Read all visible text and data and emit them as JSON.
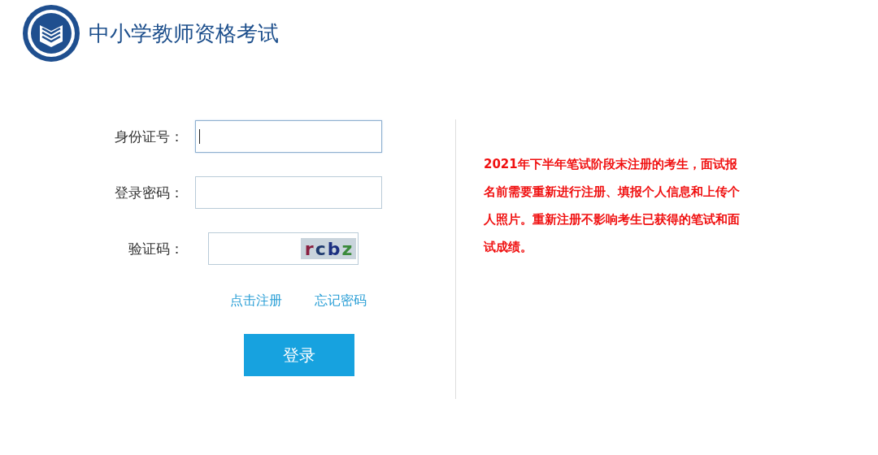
{
  "header": {
    "title": "中小学教师资格考试"
  },
  "form": {
    "fields": [
      {
        "kind": "text",
        "label": "身份证号：",
        "focused": true
      },
      {
        "kind": "password",
        "label": "登录密码：",
        "focused": false
      },
      {
        "kind": "captcha",
        "label": "验证码：",
        "focused": false,
        "captcha": "rcbz"
      }
    ],
    "links": [
      "点击注册",
      "忘记密码"
    ],
    "submit": "登录"
  },
  "notice": "2021年下半年笔试阶段末注册的考生，面试报名前需要重新进行注册、填报个人信息和上传个人照片。重新注册不影响考生已获得的笔试和面试成绩。"
}
